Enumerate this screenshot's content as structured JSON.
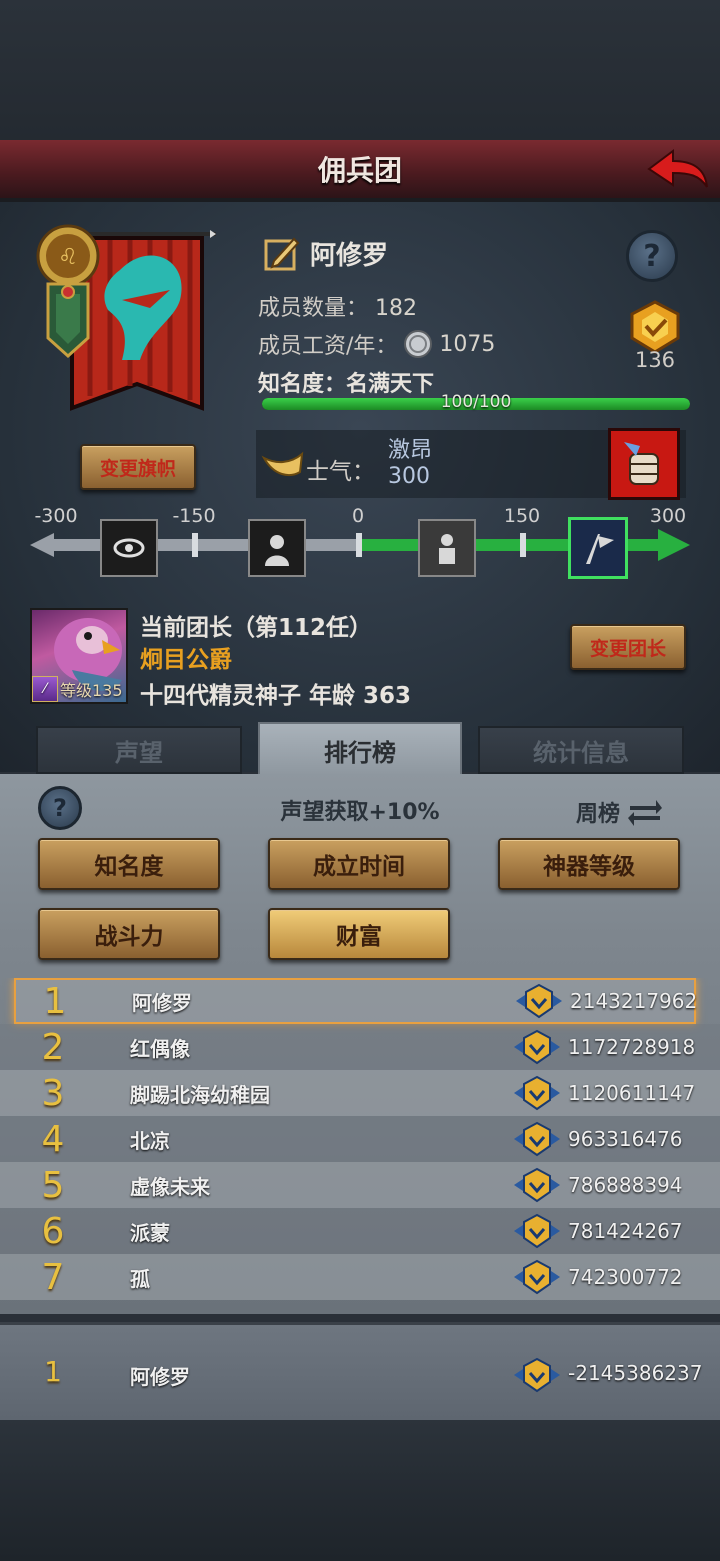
{
  "header": {
    "title": "佣兵团"
  },
  "guild": {
    "name": "阿修罗",
    "member_count_label": "成员数量：",
    "member_count": "182",
    "salary_label": "成员工资/年：",
    "salary": "1075",
    "fame_label": "知名度：名满天下",
    "fame_progress_text": "100/100",
    "fame_progress": 1.0,
    "rank_number": "136",
    "change_flag_label": "变更旗帜",
    "morale_label": "士气：",
    "morale_state": "激昂",
    "morale_value": "300"
  },
  "morale_scale": {
    "ticks": [
      "-300",
      "-150",
      "0",
      "150",
      "300"
    ],
    "current": 300
  },
  "leader": {
    "title_line": "当前团长（第112任）",
    "name": "炯目公爵",
    "desc_line": "十四代精灵神子 年龄 363",
    "level_label": "等级135",
    "change_leader_label": "变更团长"
  },
  "tabs": [
    {
      "label": "声望"
    },
    {
      "label": "排行榜"
    },
    {
      "label": "统计信息"
    }
  ],
  "ranking": {
    "bonus_text": "声望获取+10%",
    "period_label": "周榜",
    "filters": [
      {
        "label": "知名度"
      },
      {
        "label": "成立时间"
      },
      {
        "label": "神器等级"
      },
      {
        "label": "战斗力"
      },
      {
        "label": "财富"
      }
    ],
    "rows": [
      {
        "rank": "1",
        "name": "阿修罗",
        "score": "2143217962"
      },
      {
        "rank": "2",
        "name": "红偶像",
        "score": "1172728918"
      },
      {
        "rank": "3",
        "name": "脚踢北海幼稚园",
        "score": "1120611147"
      },
      {
        "rank": "4",
        "name": "北凉",
        "score": "963316476"
      },
      {
        "rank": "5",
        "name": "虚像未来",
        "score": "786888394"
      },
      {
        "rank": "6",
        "name": "派蒙",
        "score": "781424267"
      },
      {
        "rank": "7",
        "name": "孤",
        "score": "742300772"
      }
    ],
    "mine": {
      "rank": "1",
      "name": "阿修罗",
      "score": "-2145386237"
    }
  },
  "colors": {
    "title_bar": "#7a2a30",
    "button_gold": "#c9a060",
    "fame_green": "#3ad04a",
    "rank_gold": "#e8c040",
    "banner_red": "#b8281a",
    "banner_teal": "#2ab8b0"
  }
}
